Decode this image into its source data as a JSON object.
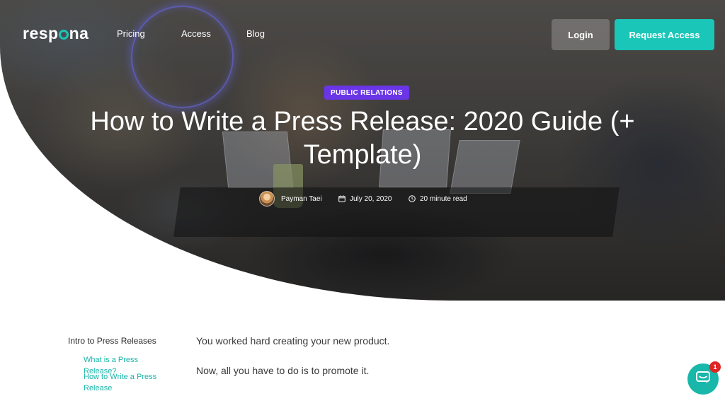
{
  "nav": {
    "logo_text": "respona",
    "links": [
      "Pricing",
      "Access",
      "Blog"
    ],
    "login_label": "Login",
    "request_label": "Request Access"
  },
  "hero": {
    "category": "PUBLIC RELATIONS",
    "title": "How to Write a Press Release: 2020 Guide (+ Template)",
    "author": "Payman Taei",
    "date": "July 20, 2020",
    "read_time": "20 minute read"
  },
  "toc": {
    "heading": "Intro to Press Releases",
    "items": [
      "What is a Press Release?",
      "How to Write a Press Release"
    ]
  },
  "body": {
    "paragraphs": [
      "You worked hard creating your new product.",
      "Now, all you have to do is to promote it."
    ]
  },
  "chat": {
    "badge_count": "1",
    "icon": "chat-icon"
  },
  "colors": {
    "accent": "#19c6b8",
    "badge": "#6a35e6",
    "notification": "#e02424"
  }
}
